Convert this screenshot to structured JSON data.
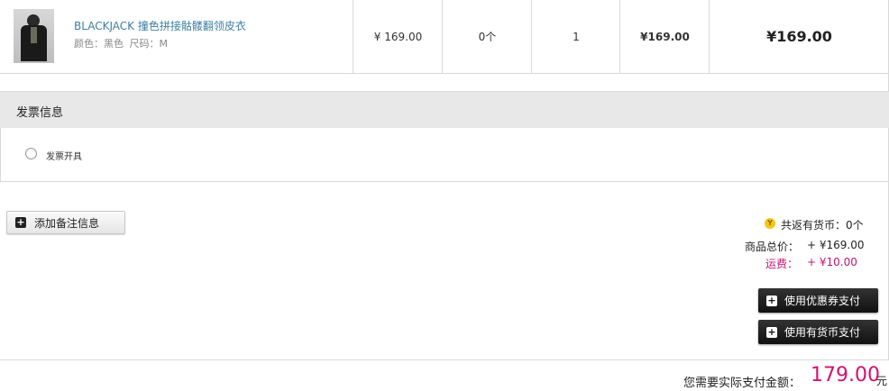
{
  "product": {
    "name": "BLACKJACK 撞色拼接骷髅翻领皮衣",
    "color_label": "颜色：黑色",
    "size_label": "尺码：M",
    "unit_price": "¥ 169.00",
    "coins": "0个",
    "quantity": "1",
    "subtotal": "¥169.00",
    "total": "¥169.00"
  },
  "invoice": {
    "title": "发票信息",
    "option_label": "发票开具"
  },
  "note": {
    "button_label": "添加备注信息"
  },
  "summary": {
    "coin_icon": "Y",
    "coin_text": "共返有货币：0个",
    "goods_label": "商品总价：",
    "goods_value": "+ ¥169.00",
    "shipping_label": "运费：",
    "shipping_value": "+ ¥10.00"
  },
  "actions": {
    "coupon_button": "使用优惠券支付",
    "coin_button": "使用有货币支付"
  },
  "payment": {
    "label": "您需要实际支付金额：",
    "amount": "179.00",
    "unit": "元"
  },
  "colors": {
    "accent_pink": "#d6106e",
    "link_blue": "#3f7fa0"
  }
}
